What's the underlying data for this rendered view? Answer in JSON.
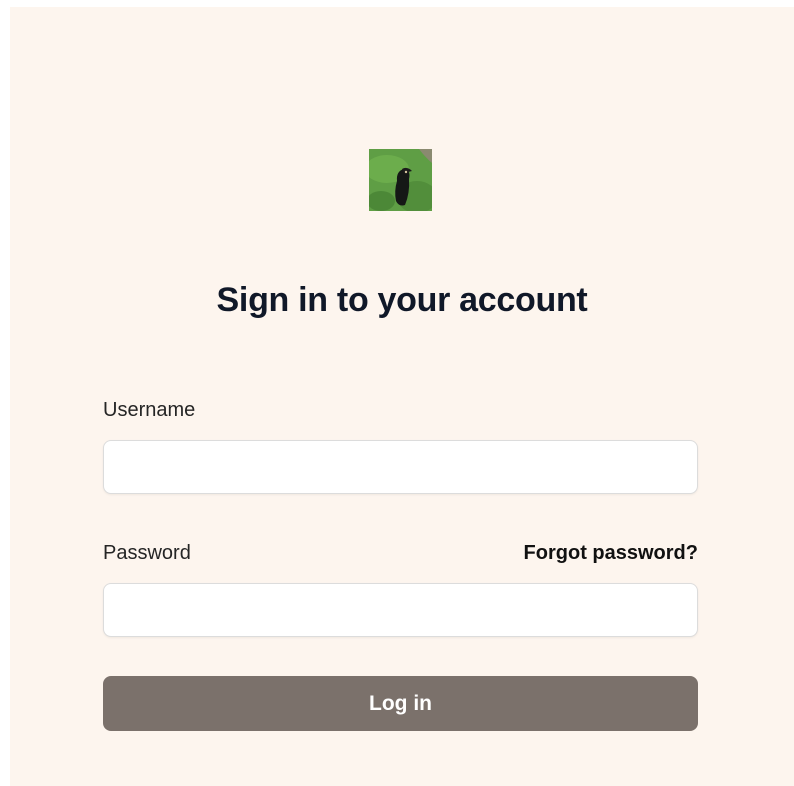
{
  "header": {
    "logo_icon": "bird-photo-logo",
    "title": "Sign in to your account"
  },
  "form": {
    "username_label": "Username",
    "username_value": "",
    "password_label": "Password",
    "password_value": "",
    "forgot_password_link": "Forgot password?",
    "submit_label": "Log in"
  },
  "colors": {
    "background": "#fdf5ee",
    "button": "#7b716b",
    "title": "#101828"
  }
}
